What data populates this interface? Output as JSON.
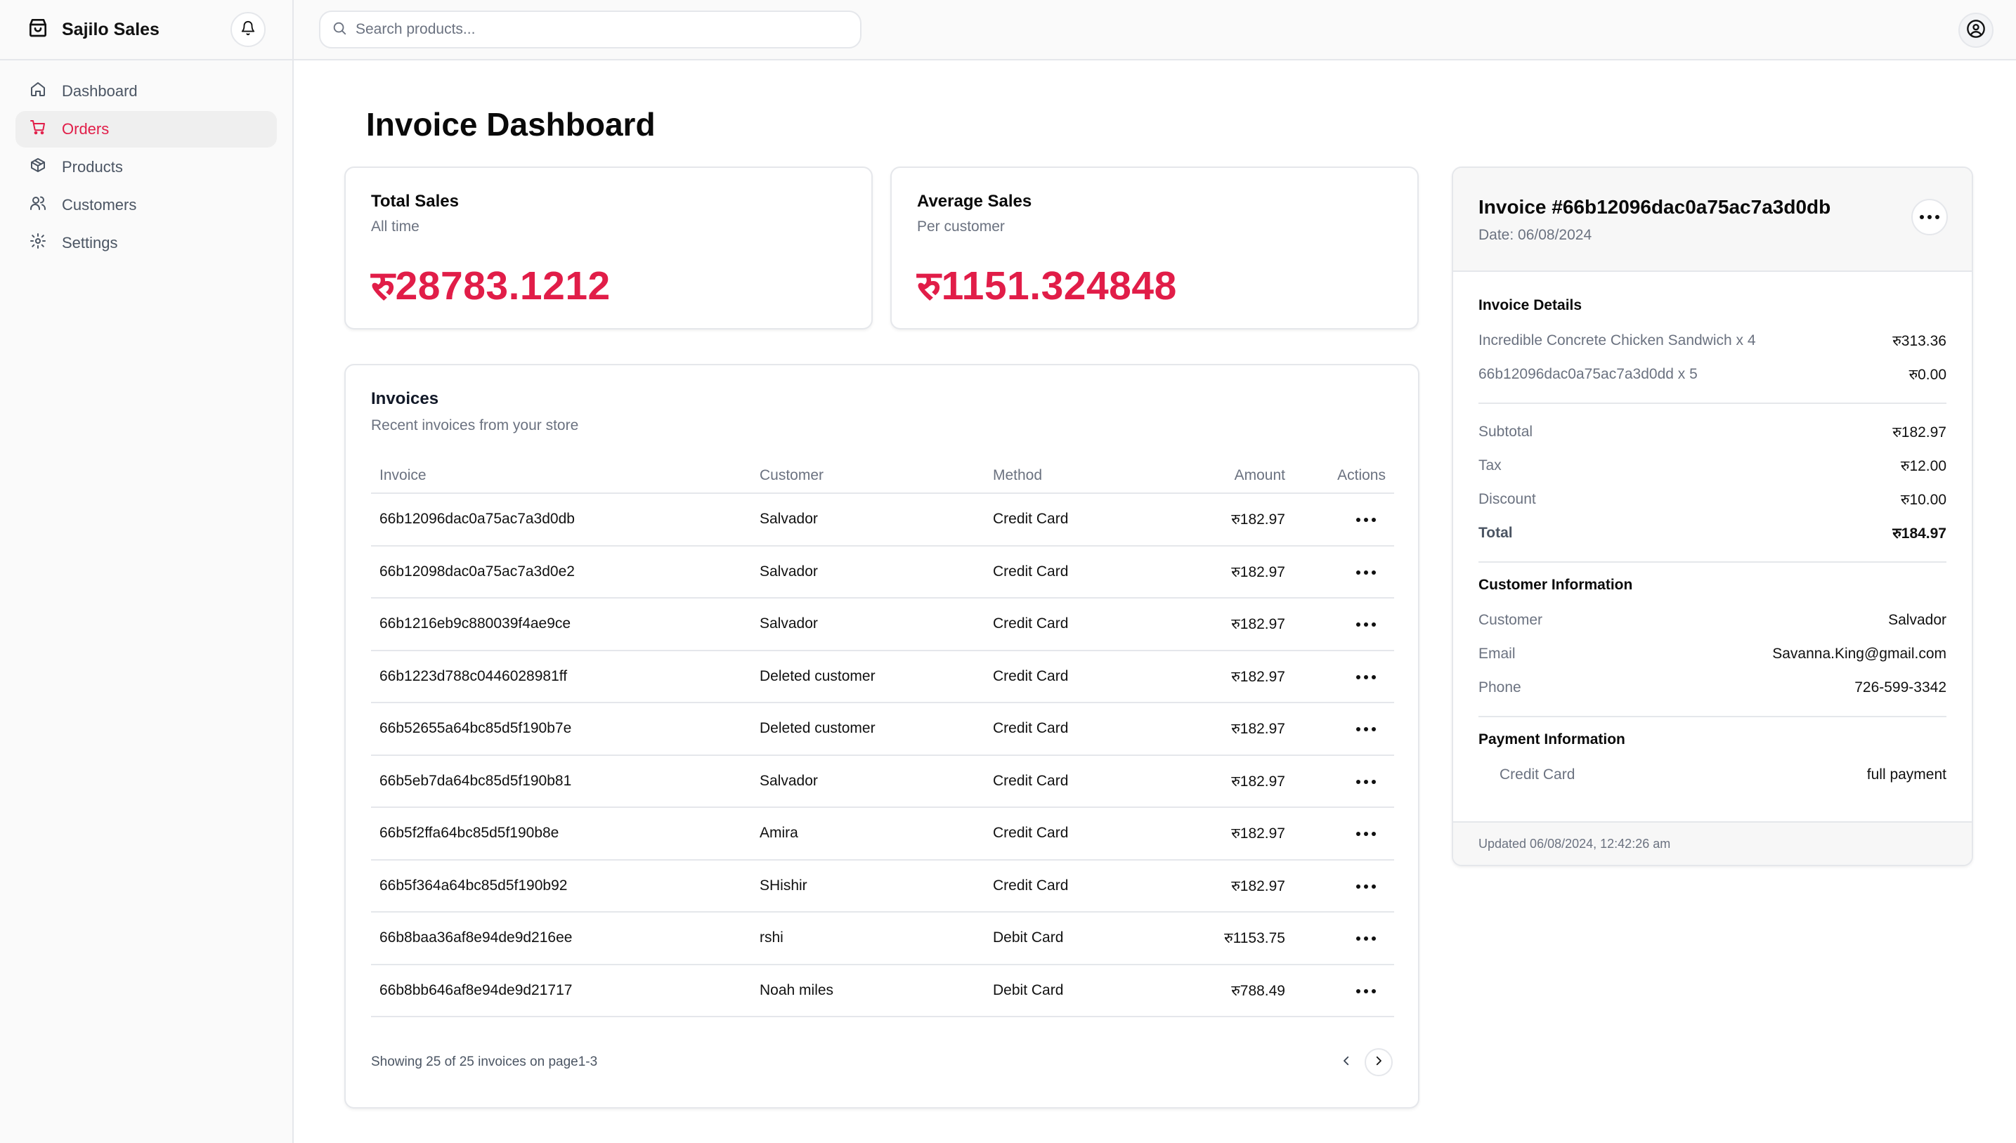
{
  "app": {
    "name": "Sajilo Sales"
  },
  "sidebar": {
    "items": [
      {
        "label": "Dashboard",
        "icon": "home-icon",
        "active": false
      },
      {
        "label": "Orders",
        "icon": "cart-icon",
        "active": true
      },
      {
        "label": "Products",
        "icon": "package-icon",
        "active": false
      },
      {
        "label": "Customers",
        "icon": "users-icon",
        "active": false
      },
      {
        "label": "Settings",
        "icon": "gear-icon",
        "active": false
      }
    ]
  },
  "search": {
    "placeholder": "Search products..."
  },
  "page": {
    "title": "Invoice Dashboard"
  },
  "stats": {
    "total": {
      "title": "Total Sales",
      "subtitle": "All time",
      "value": "रु28783.1212"
    },
    "average": {
      "title": "Average Sales",
      "subtitle": "Per customer",
      "value": "रु1151.324848"
    }
  },
  "invoices": {
    "title": "Invoices",
    "subtitle": "Recent invoices from your store",
    "columns": {
      "invoice": "Invoice",
      "customer": "Customer",
      "method": "Method",
      "amount": "Amount",
      "actions": "Actions"
    },
    "rows": [
      {
        "invoice": "66b12096dac0a75ac7a3d0db",
        "customer": "Salvador",
        "method": "Credit Card",
        "amount": "रु182.97"
      },
      {
        "invoice": "66b12098dac0a75ac7a3d0e2",
        "customer": "Salvador",
        "method": "Credit Card",
        "amount": "रु182.97"
      },
      {
        "invoice": "66b1216eb9c880039f4ae9ce",
        "customer": "Salvador",
        "method": "Credit Card",
        "amount": "रु182.97"
      },
      {
        "invoice": "66b1223d788c0446028981ff",
        "customer": "Deleted customer",
        "method": "Credit Card",
        "amount": "रु182.97"
      },
      {
        "invoice": "66b52655a64bc85d5f190b7e",
        "customer": "Deleted customer",
        "method": "Credit Card",
        "amount": "रु182.97"
      },
      {
        "invoice": "66b5eb7da64bc85d5f190b81",
        "customer": "Salvador",
        "method": "Credit Card",
        "amount": "रु182.97"
      },
      {
        "invoice": "66b5f2ffa64bc85d5f190b8e",
        "customer": "Amira",
        "method": "Credit Card",
        "amount": "रु182.97"
      },
      {
        "invoice": "66b5f364a64bc85d5f190b92",
        "customer": "SHishir",
        "method": "Credit Card",
        "amount": "रु182.97"
      },
      {
        "invoice": "66b8baa36af8e94de9d216ee",
        "customer": "rshi",
        "method": "Debit Card",
        "amount": "रु1153.75"
      },
      {
        "invoice": "66b8bb646af8e94de9d21717",
        "customer": "Noah miles",
        "method": "Debit Card",
        "amount": "रु788.49"
      }
    ],
    "pagination_text": "Showing 25 of 25 invoices on page1-3"
  },
  "detail": {
    "title": "Invoice #66b12096dac0a75ac7a3d0db",
    "date": "Date: 06/08/2024",
    "details_title": "Invoice Details",
    "items": [
      {
        "name": "Incredible Concrete Chicken Sandwich x 4",
        "price": "रु313.36"
      },
      {
        "name": "66b12096dac0a75ac7a3d0dd x 5",
        "price": "रु0.00"
      }
    ],
    "subtotal_label": "Subtotal",
    "subtotal": "रु182.97",
    "tax_label": "Tax",
    "tax": "रु12.00",
    "discount_label": "Discount",
    "discount": "रु10.00",
    "total_label": "Total",
    "total": "रु184.97",
    "customer_title": "Customer Information",
    "customer_label": "Customer",
    "customer": "Salvador",
    "email_label": "Email",
    "email": "Savanna.King@gmail.com",
    "phone_label": "Phone",
    "phone": "726-599-3342",
    "payment_title": "Payment Information",
    "payment_method": "Credit Card",
    "payment_type": "full payment",
    "updated": "Updated 06/08/2024, 12:42:26 am"
  },
  "colors": {
    "accent": "#e11d48",
    "muted": "#6b7280",
    "border": "#e5e7eb"
  }
}
